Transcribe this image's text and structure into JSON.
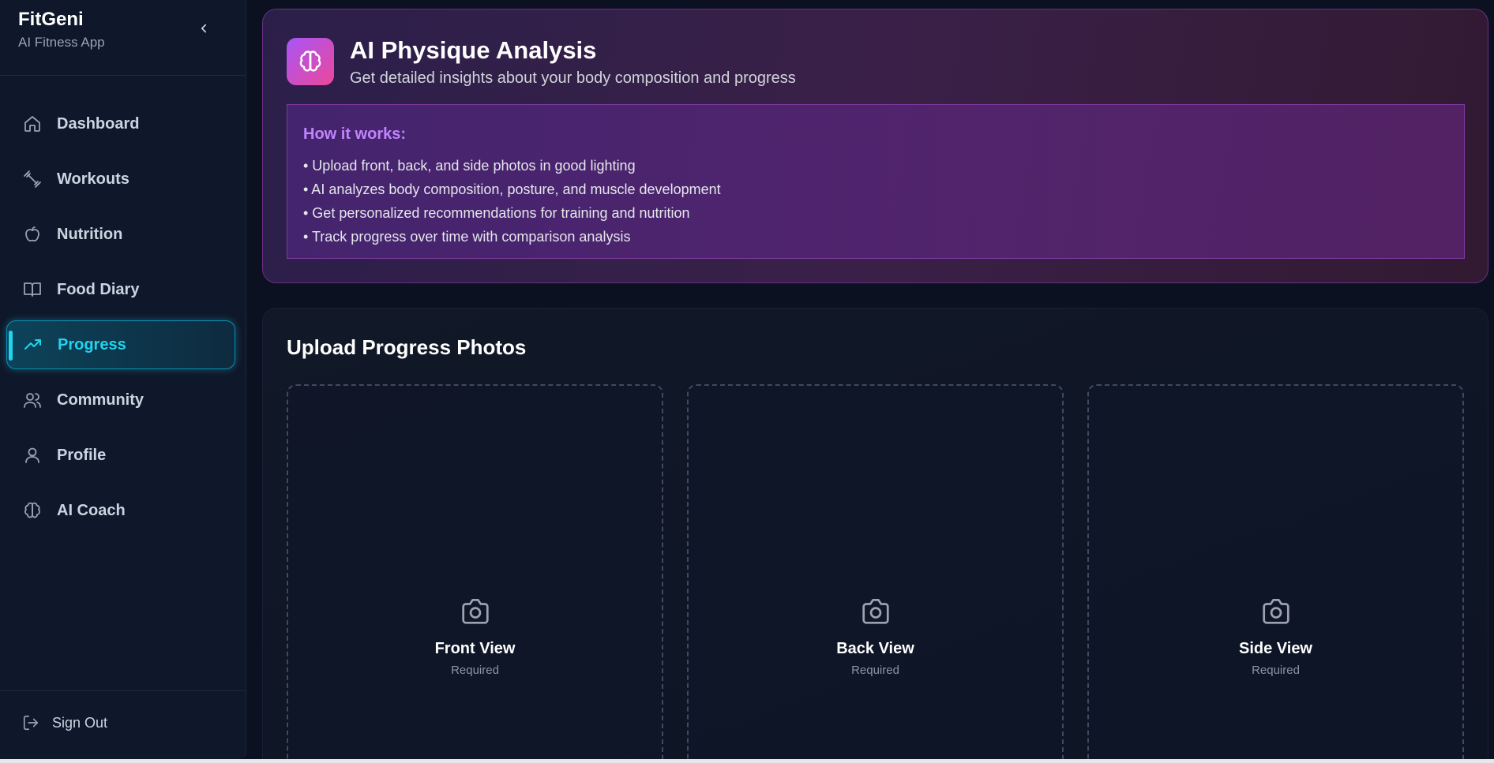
{
  "app": {
    "name": "FitGeni",
    "subtitle": "AI Fitness App"
  },
  "sidebar": {
    "items": [
      {
        "label": "Dashboard",
        "icon": "home-icon",
        "active": false
      },
      {
        "label": "Workouts",
        "icon": "dumbbell-icon",
        "active": false
      },
      {
        "label": "Nutrition",
        "icon": "apple-icon",
        "active": false
      },
      {
        "label": "Food Diary",
        "icon": "book-icon",
        "active": false
      },
      {
        "label": "Progress",
        "icon": "trending-up-icon",
        "active": true
      },
      {
        "label": "Community",
        "icon": "users-icon",
        "active": false
      },
      {
        "label": "Profile",
        "icon": "user-icon",
        "active": false
      },
      {
        "label": "AI Coach",
        "icon": "brain-icon",
        "active": false
      }
    ],
    "sign_out": "Sign Out"
  },
  "hero": {
    "title": "AI Physique Analysis",
    "subtitle": "Get detailed insights about your body composition and progress",
    "how_title": "How it works:",
    "how_items": [
      "• Upload front, back, and side photos in good lighting",
      "• AI analyzes body composition, posture, and muscle development",
      "• Get personalized recommendations for training and nutrition",
      "• Track progress over time with comparison analysis"
    ]
  },
  "upload": {
    "title": "Upload Progress Photos",
    "slots": [
      {
        "title": "Front View",
        "note": "Required"
      },
      {
        "title": "Back View",
        "note": "Required"
      },
      {
        "title": "Side View",
        "note": "Required"
      }
    ]
  },
  "colors": {
    "accent": "#22d3ee",
    "purple": "#c084fc",
    "background": "#0b1120"
  }
}
